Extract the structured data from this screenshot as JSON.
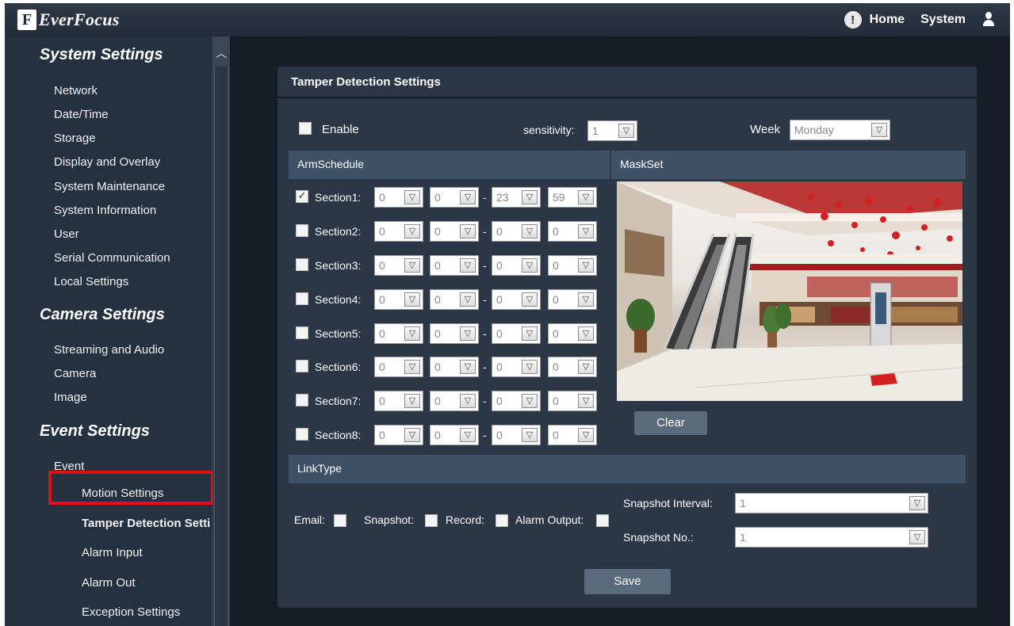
{
  "brand": {
    "logo_mark": "F",
    "name": "EverFocus"
  },
  "topnav": {
    "alert_icon": "!",
    "home": "Home",
    "system": "System",
    "user_icon": "user-icon"
  },
  "sidebar": {
    "system_settings": "System Settings",
    "system_items": [
      "Network",
      "Date/Time",
      "Storage",
      "Display and Overlay",
      "System Maintenance",
      "System Information",
      "User",
      "Serial Communication",
      "Local Settings"
    ],
    "camera_settings": "Camera Settings",
    "camera_items": [
      "Streaming and Audio",
      "Camera",
      "Image"
    ],
    "event_settings": "Event Settings",
    "event_item": "Event",
    "event_sub_items": [
      "Motion Settings",
      "Tamper Detection Setti",
      "Alarm Input",
      "Alarm Out",
      "Exception Settings"
    ],
    "active_item": "Tamper Detection Setti"
  },
  "panel": {
    "title": "Tamper Detection Settings",
    "enable_label": "Enable",
    "enable_checked": false,
    "sensitivity_label": "sensitivity:",
    "sensitivity_value": "1",
    "week_label": "Week",
    "week_value": "Monday",
    "arm_schedule_header": "ArmSchedule",
    "mask_set_header": "MaskSet",
    "sections": [
      {
        "label": "Section1:",
        "checked": true,
        "checkmark": "✓",
        "start_h": "0",
        "start_m": "0",
        "end_h": "23",
        "end_m": "59"
      },
      {
        "label": "Section2:",
        "checked": false,
        "checkmark": "",
        "start_h": "0",
        "start_m": "0",
        "end_h": "0",
        "end_m": "0"
      },
      {
        "label": "Section3:",
        "checked": false,
        "checkmark": "",
        "start_h": "0",
        "start_m": "0",
        "end_h": "0",
        "end_m": "0"
      },
      {
        "label": "Section4:",
        "checked": false,
        "checkmark": "",
        "start_h": "0",
        "start_m": "0",
        "end_h": "0",
        "end_m": "0"
      },
      {
        "label": "Section5:",
        "checked": false,
        "checkmark": "",
        "start_h": "0",
        "start_m": "0",
        "end_h": "0",
        "end_m": "0"
      },
      {
        "label": "Section6:",
        "checked": false,
        "checkmark": "",
        "start_h": "0",
        "start_m": "0",
        "end_h": "0",
        "end_m": "0"
      },
      {
        "label": "Section7:",
        "checked": false,
        "checkmark": "",
        "start_h": "0",
        "start_m": "0",
        "end_h": "0",
        "end_m": "0"
      },
      {
        "label": "Section8:",
        "checked": false,
        "checkmark": "",
        "start_h": "0",
        "start_m": "0",
        "end_h": "0",
        "end_m": "0"
      }
    ],
    "dash": "-",
    "clear_button": "Clear",
    "link_type_header": "LinkType",
    "email_label": "Email:",
    "snapshot_label": "Snapshot:",
    "record_label": "Record:",
    "alarm_output_label": "Alarm Output:",
    "snapshot_interval_label": "Snapshot Interval:",
    "snapshot_interval_value": "1",
    "snapshot_no_label": "Snapshot No.:",
    "snapshot_no_value": "1",
    "save_button": "Save"
  },
  "colors": {
    "topbar": "#232c39",
    "sidebar": "#243140",
    "panel": "#2b3646",
    "bar": "#3e5166",
    "highlight": "#e01010",
    "button": "#5a6a7d"
  }
}
